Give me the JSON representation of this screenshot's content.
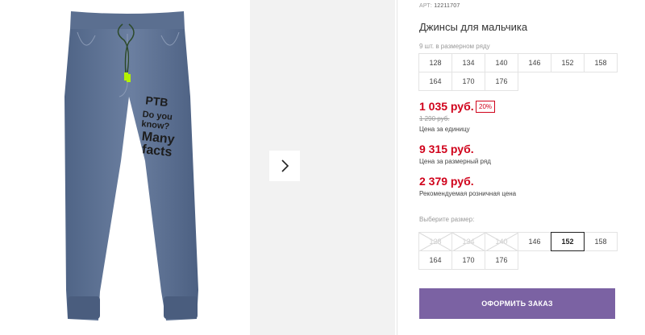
{
  "product": {
    "article_label": "АРТ:",
    "article_value": "12211707",
    "title": "Джинсы для мальчика"
  },
  "pack": {
    "label": "9 шт. в размерном ряду",
    "sizes": [
      "128",
      "134",
      "140",
      "146",
      "152",
      "158",
      "164",
      "170",
      "176"
    ]
  },
  "prices": {
    "unit_price": "1 035 руб.",
    "discount_badge": "20%",
    "old_price": "1 290 руб.",
    "unit_caption": "Цена за единицу",
    "pack_price": "9 315 руб.",
    "pack_caption": "Цена за размерный ряд",
    "retail_price": "2 379 руб.",
    "retail_caption": "Рекомендуемая розничная цена"
  },
  "size_select": {
    "label": "Выберите размер:",
    "sizes": [
      {
        "value": "128",
        "available": false,
        "selected": false
      },
      {
        "value": "134",
        "available": false,
        "selected": false
      },
      {
        "value": "140",
        "available": false,
        "selected": false
      },
      {
        "value": "146",
        "available": true,
        "selected": false
      },
      {
        "value": "152",
        "available": true,
        "selected": true
      },
      {
        "value": "158",
        "available": true,
        "selected": false
      },
      {
        "value": "164",
        "available": true,
        "selected": false
      },
      {
        "value": "170",
        "available": true,
        "selected": false
      },
      {
        "value": "176",
        "available": true,
        "selected": false
      }
    ]
  },
  "actions": {
    "order_label": "ОФОРМИТЬ ЗАКАЗ"
  },
  "photo": {
    "print_lines": [
      "PTB",
      "Do you",
      "know?",
      "Many",
      "facts"
    ]
  },
  "colors": {
    "price_red": "#d0021b",
    "button_purple": "#7b62a3",
    "denim": "#5a6f8f"
  },
  "icons": {
    "next": "chevron-right-icon"
  }
}
